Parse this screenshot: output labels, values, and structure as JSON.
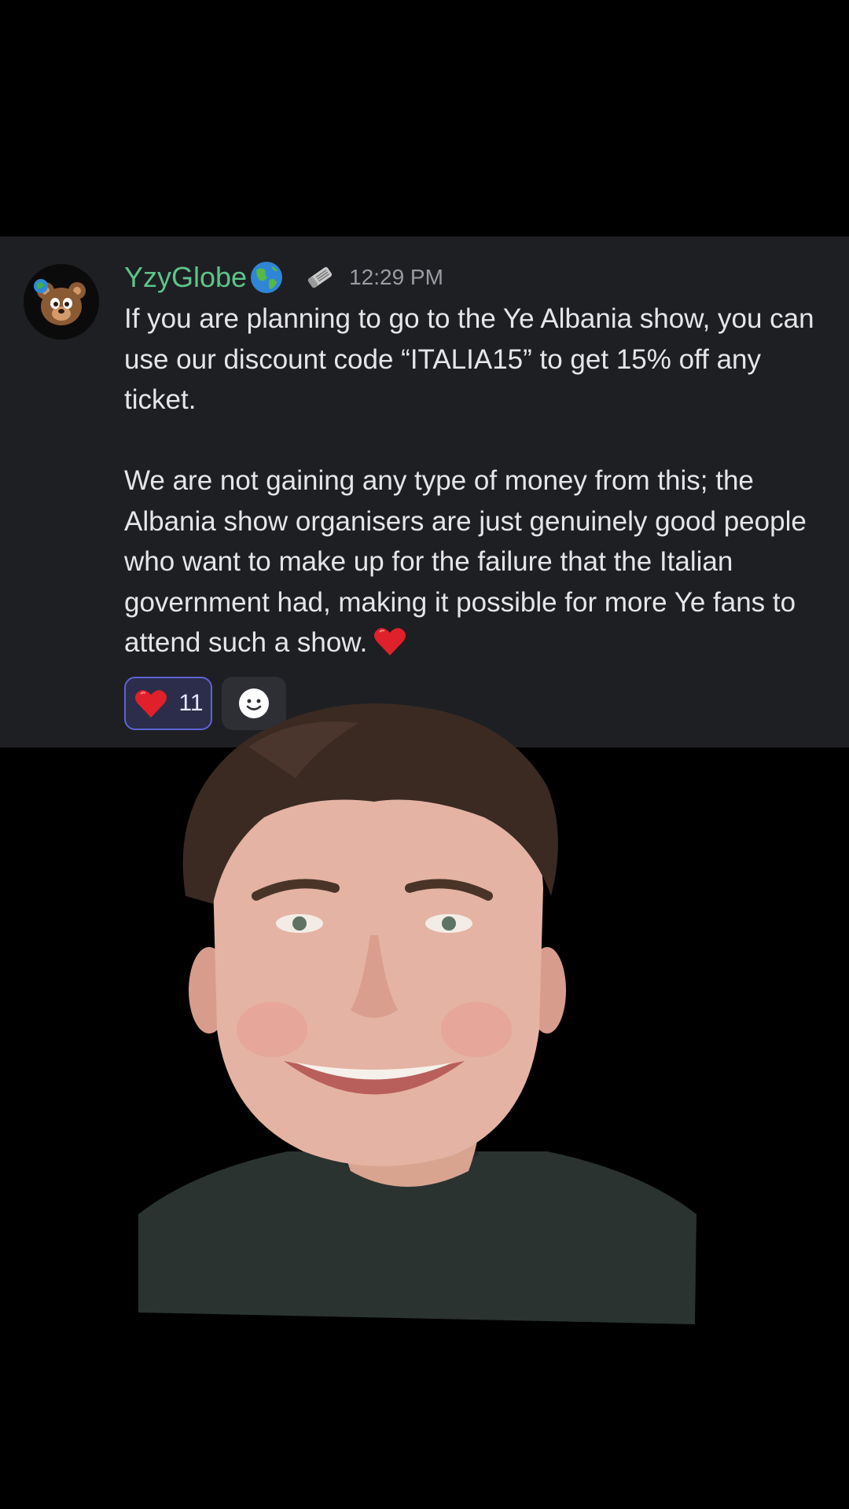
{
  "message": {
    "username": "YzyGlobe",
    "badge_icon": "globe-icon",
    "app_icon": "newspaper-icon",
    "timestamp": "12:29 PM",
    "paragraph_1": "If you are planning to go to the Ye Albania show, you can use our discount code “ITALIA15” to get 15% off any ticket.",
    "paragraph_2": "We are not gaining any type of money from this; the Albania show organisers are just genuinely good people who want to make up for the failure that the Italian government had, making it possible for more Ye fans to attend such a show.",
    "inline_emoji": "heart-icon"
  },
  "reactions": [
    {
      "icon": "heart-icon",
      "count": "11"
    }
  ],
  "add_reaction_icon": "smiley-icon",
  "colors": {
    "username": "#5ec48a",
    "card_bg": "#1e1f22",
    "reaction_border": "#5c64d4",
    "reaction_bg": "#2b2d4a"
  }
}
